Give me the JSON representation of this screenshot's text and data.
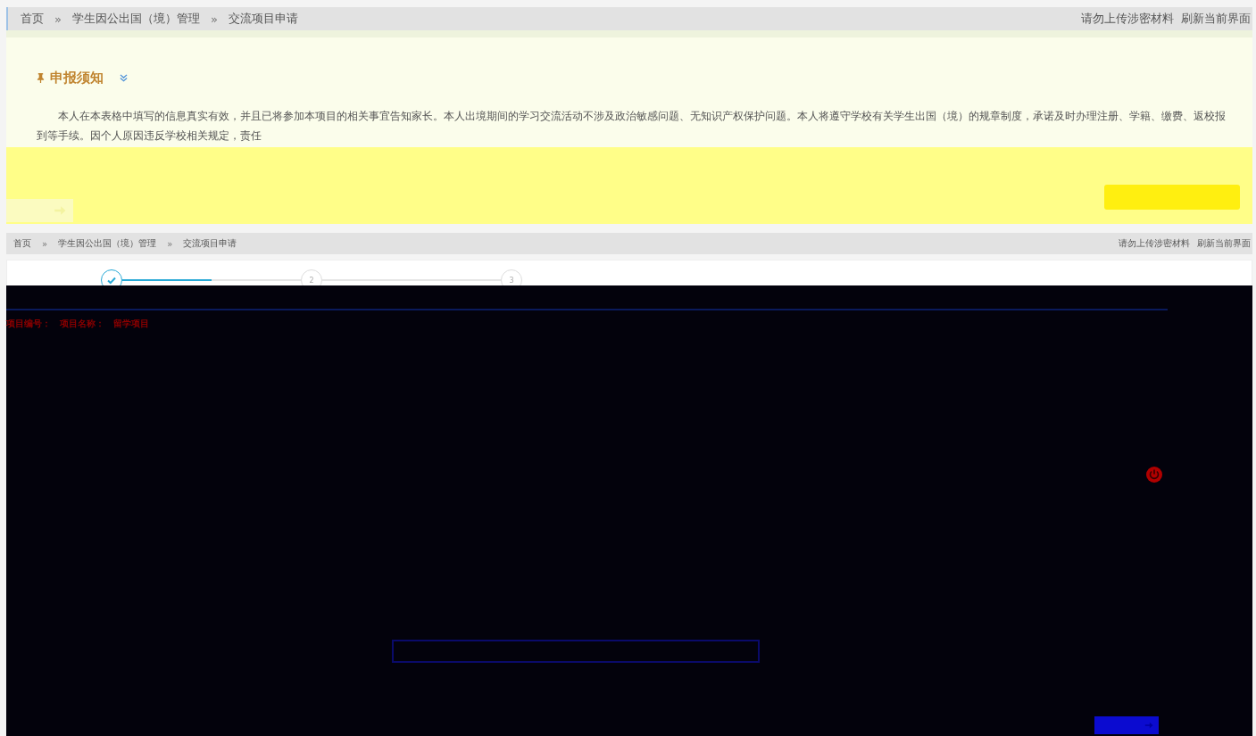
{
  "top_page": {
    "breadcrumb": [
      "首页",
      "学生因公出国（境）管理",
      "交流项目申请"
    ],
    "separator": "»",
    "actions": [
      "请勿上传涉密材料",
      "刷新当前界面"
    ],
    "notice": {
      "title": "申报须知",
      "text": "本人在本表格中填写的信息真实有效，并且已将参加本项目的相关事宜告知家长。本人出境期间的学习交流活动不涉及政治敏感问题、无知识产权保护问题。本人将遵守学校有关学生出国（境）的规章制度，承诺及时办理注册、学籍、缴费、返校报到等手续。因个人原因违反学校相关规定，责任"
    }
  },
  "form_page": {
    "breadcrumb": [
      "首页",
      "学生因公出国（境）管理",
      "交流项目申请"
    ],
    "separator": "»",
    "actions": [
      "请勿上传涉密材料",
      "刷新当前界面"
    ],
    "steps": [
      {
        "done": true
      },
      {
        "done": false,
        "number": "2"
      },
      {
        "done": false,
        "number": "3"
      }
    ],
    "connectors": [
      {
        "level": 0.5
      }
    ],
    "fields": [
      "项目编号：",
      "项目名称：",
      "留学项目"
    ]
  }
}
